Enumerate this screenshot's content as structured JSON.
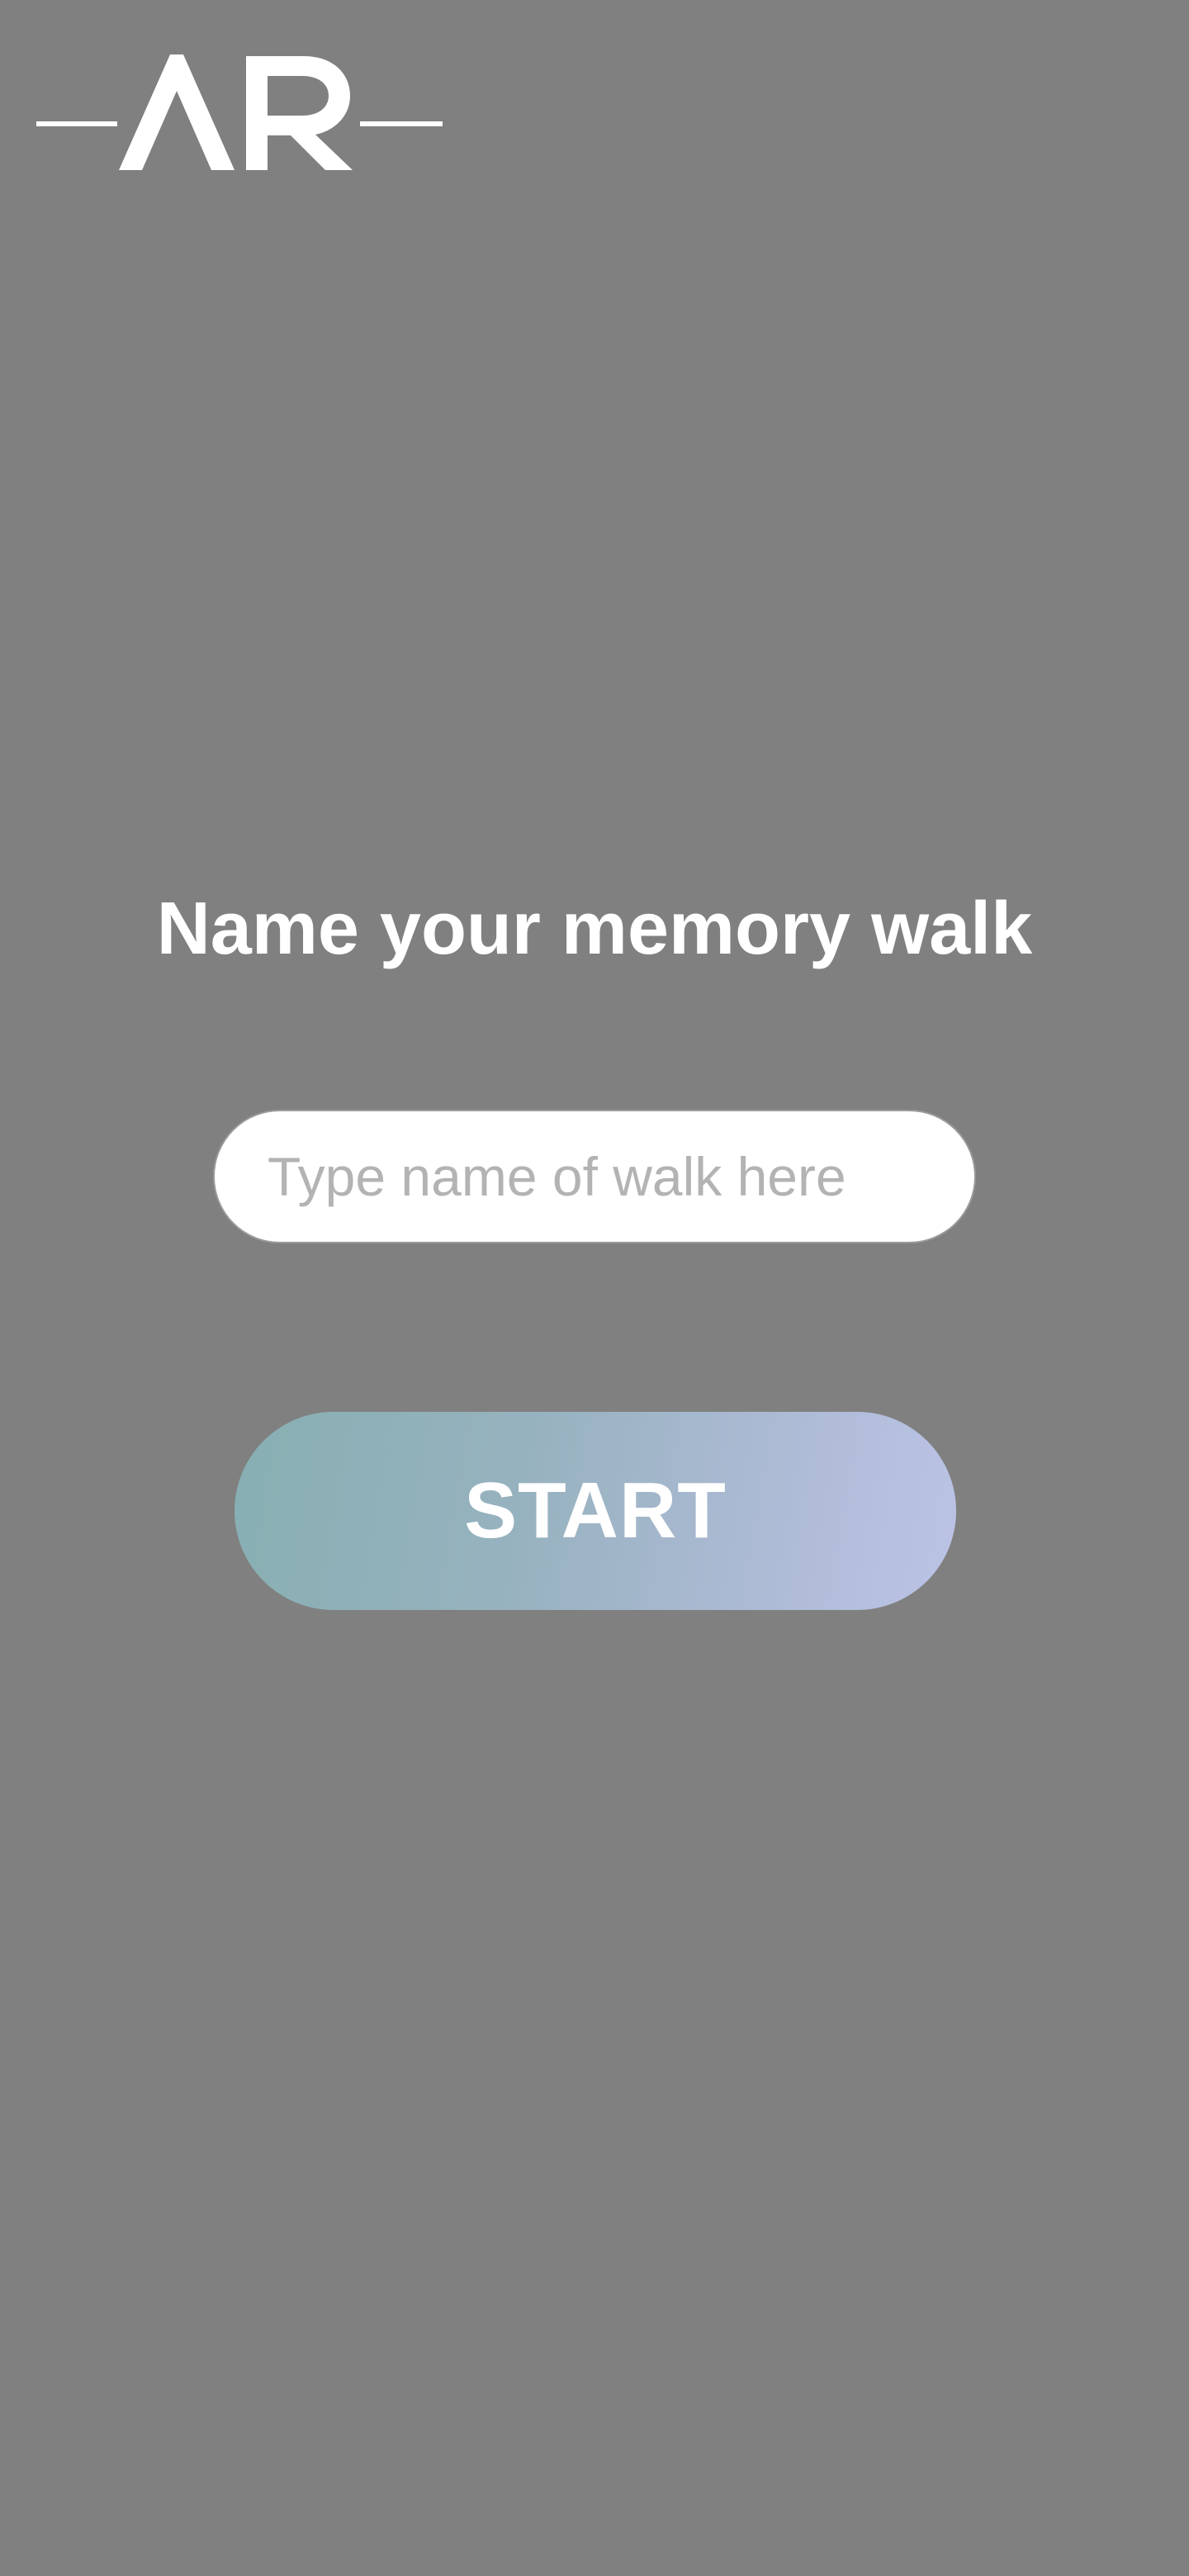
{
  "app": {
    "logo_name": "ar-logo",
    "logo_text": "AR",
    "background_color": "#808080"
  },
  "main": {
    "title": "Name your memory walk",
    "walk_name_input": {
      "value": "",
      "placeholder": "Type name of walk here"
    },
    "start_label": "START",
    "start_gradient": [
      "#87afb2",
      "#bcc3e6"
    ]
  }
}
